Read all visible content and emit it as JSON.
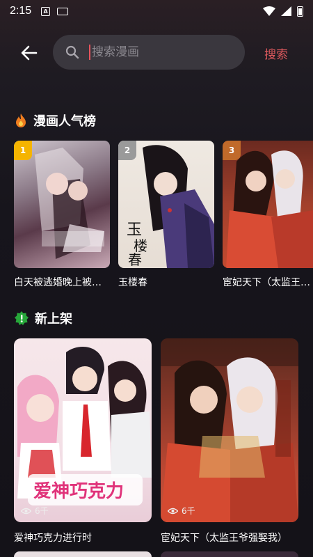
{
  "status_bar": {
    "time": "2:15",
    "notif_glyph": "A"
  },
  "search": {
    "placeholder": "搜索漫画",
    "button_label": "搜索"
  },
  "sections": {
    "hot": {
      "title": "漫画人气榜",
      "icon": "flame-icon",
      "items": [
        {
          "rank": "1",
          "title": "白天被逃婚晚上被…",
          "badge_color": "#f5b400"
        },
        {
          "rank": "2",
          "title": "玉楼春",
          "badge_color": "#9a9a9a"
        },
        {
          "rank": "3",
          "title": "宦妃天下（太监王…",
          "badge_color": "#c06a2a"
        }
      ]
    },
    "new": {
      "title": "新上架",
      "icon": "new-badge-icon",
      "items": [
        {
          "title": "爱神巧克力进行时",
          "views": "6千"
        },
        {
          "title": "宦妃天下（太监王爷强娶我）",
          "views": "6千"
        }
      ]
    }
  },
  "colors": {
    "accent": "#e05a5e",
    "search_bg": "#3a373e",
    "new_badge": "#27a83a"
  }
}
